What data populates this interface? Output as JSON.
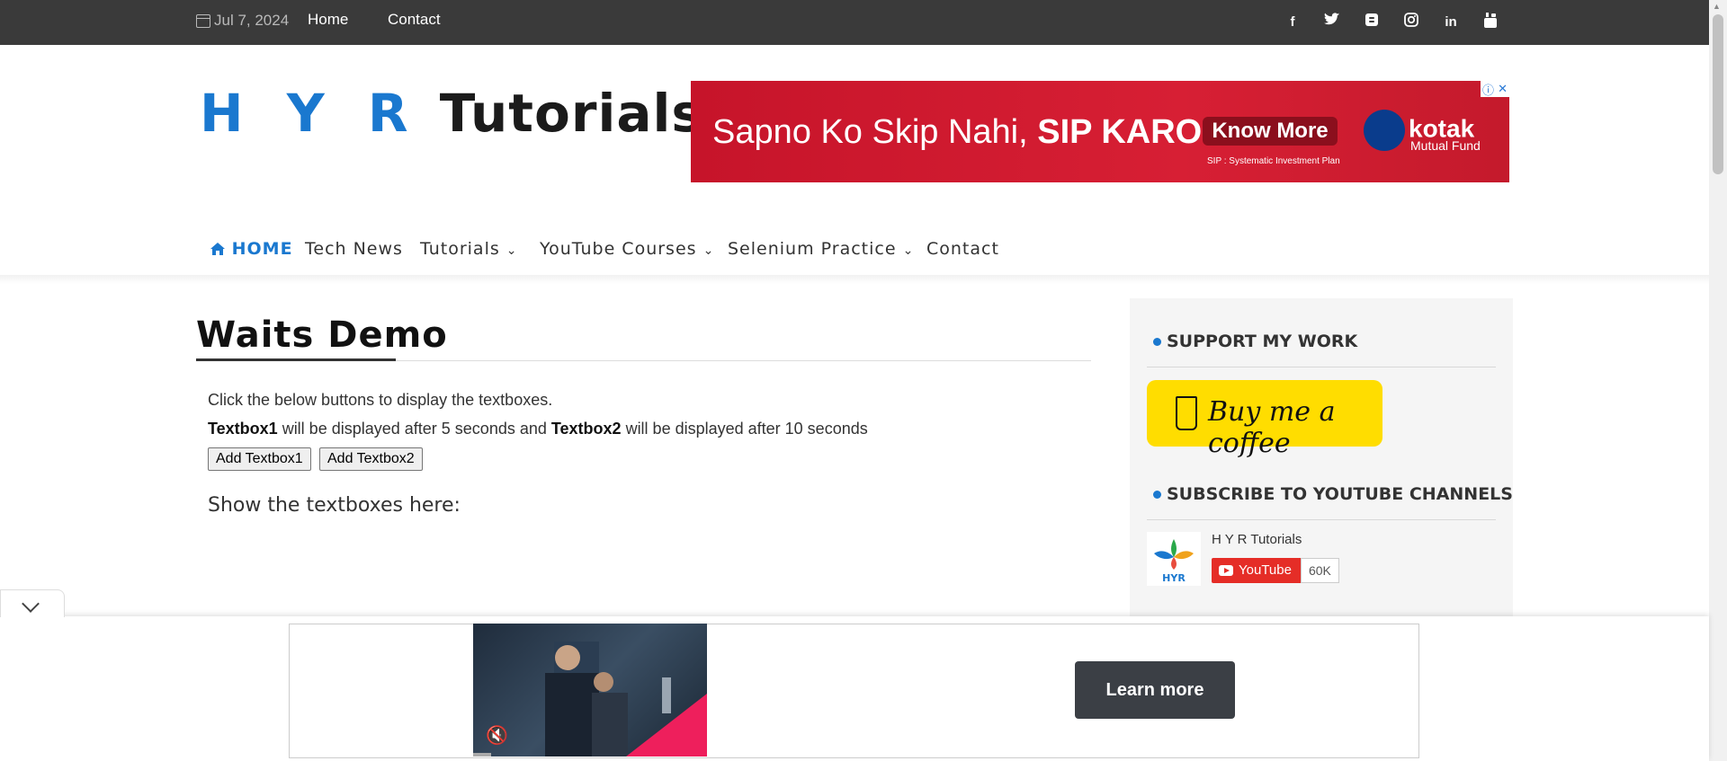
{
  "topbar": {
    "date": "Jul 7, 2024",
    "links": [
      "Home",
      "Contact"
    ],
    "social_icons": [
      "facebook-icon",
      "twitter-icon",
      "blogger-icon",
      "instagram-icon",
      "linkedin-icon",
      "youtube-icon"
    ]
  },
  "header": {
    "logo_part1": "H Y R",
    "logo_part2": "Tutorials",
    "ad": {
      "tag_plain": "Sapno Ko Skip Nahi,",
      "tag_bold": "SIP KARO!",
      "cta": "Know More",
      "brand": "kotak",
      "brand_sub": "Mutual Fund",
      "fine_print": "SIP : Systematic Investment Plan"
    }
  },
  "nav": {
    "items": [
      {
        "label": "HOME"
      },
      {
        "label": "Tech News"
      },
      {
        "label": "Tutorials"
      },
      {
        "label": "YouTube Courses"
      },
      {
        "label": "Selenium Practice"
      },
      {
        "label": "Contact"
      }
    ]
  },
  "content": {
    "title": "Waits Demo",
    "instruction": "Click the below buttons to display the textboxes.",
    "line2": {
      "tb1": "Textbox1",
      "mid": " will be displayed after 5 seconds and ",
      "tb2": "Textbox2",
      "end": " will be displayed after 10 seconds"
    },
    "buttons": [
      "Add Textbox1",
      "Add Textbox2"
    ],
    "show_label": "Show the textboxes here:"
  },
  "sidebar": {
    "support_title": "SUPPORT MY WORK",
    "coffee_label": "Buy me a coffee",
    "subscribe_title": "SUBSCRIBE TO YOUTUBE CHANNELS",
    "channel": {
      "name": "H Y R Tutorials",
      "button": "YouTube",
      "count": "60K"
    }
  },
  "bottom_ad": {
    "cta": "Learn more"
  },
  "colors": {
    "topbar": "#3a3a3a",
    "accent": "#1a78cf",
    "ad_red": "#d71f34",
    "coffee_yellow": "#ffdd00"
  }
}
